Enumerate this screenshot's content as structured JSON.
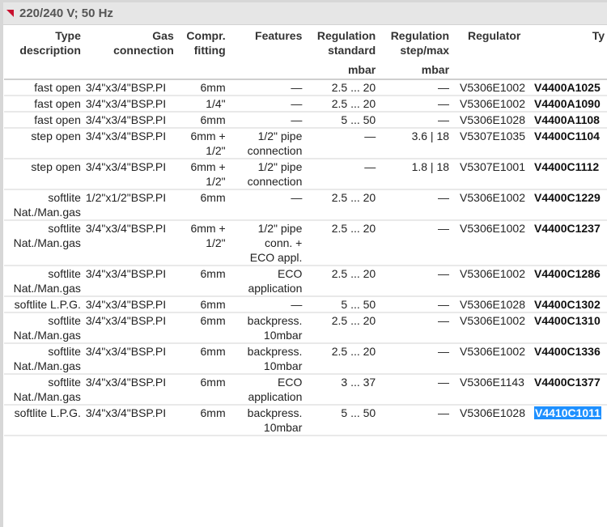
{
  "section": {
    "title": "220/240 V; 50 Hz"
  },
  "headers": {
    "type_description": [
      "Type",
      "description"
    ],
    "gas_connection": [
      "Gas",
      "connection"
    ],
    "compr_fitting": [
      "Compr.",
      "fitting"
    ],
    "features": [
      "Features"
    ],
    "regulation_standard": [
      "Regulation",
      "standard"
    ],
    "regulation_stepmax": [
      "Regulation",
      "step/max"
    ],
    "regulator": [
      "Regulator"
    ],
    "type": [
      "Ty"
    ],
    "unit_standard": "mbar",
    "unit_stepmax": "mbar"
  },
  "rows": [
    {
      "desc": [
        "fast open"
      ],
      "gas": "3/4\"x3/4\"BSP.PI",
      "compr": [
        "6mm"
      ],
      "features": [
        "—"
      ],
      "std": "2.5 ... 20",
      "step": "—",
      "regulator": "V5306E1002",
      "type": "V4400A1025"
    },
    {
      "desc": [
        "fast open"
      ],
      "gas": "3/4\"x3/4\"BSP.PI",
      "compr": [
        "1/4\""
      ],
      "features": [
        "—"
      ],
      "std": "2.5 ... 20",
      "step": "—",
      "regulator": "V5306E1002",
      "type": "V4400A1090"
    },
    {
      "desc": [
        "fast open"
      ],
      "gas": "3/4\"x3/4\"BSP.PI",
      "compr": [
        "6mm"
      ],
      "features": [
        "—"
      ],
      "std": "5 ... 50",
      "step": "—",
      "regulator": "V5306E1028",
      "type": "V4400A1108"
    },
    {
      "desc": [
        "step open"
      ],
      "gas": "3/4\"x3/4\"BSP.PI",
      "compr": [
        "6mm +",
        "1/2\""
      ],
      "features": [
        "1/2\" pipe",
        "connection"
      ],
      "std": "—",
      "step": "3.6 | 18",
      "regulator": "V5307E1035",
      "type": "V4400C1104"
    },
    {
      "desc": [
        "step open"
      ],
      "gas": "3/4\"x3/4\"BSP.PI",
      "compr": [
        "6mm +",
        "1/2\""
      ],
      "features": [
        "1/2\" pipe",
        "connection"
      ],
      "std": "—",
      "step": "1.8 | 18",
      "regulator": "V5307E1001",
      "type": "V4400C1112"
    },
    {
      "desc": [
        "softlite",
        "Nat./Man.gas"
      ],
      "gas": "1/2\"x1/2\"BSP.PI",
      "compr": [
        "6mm"
      ],
      "features": [
        "—"
      ],
      "std": "2.5 ... 20",
      "step": "—",
      "regulator": "V5306E1002",
      "type": "V4400C1229"
    },
    {
      "desc": [
        "softlite",
        "Nat./Man.gas"
      ],
      "gas": "3/4\"x3/4\"BSP.PI",
      "compr": [
        "6mm +",
        "1/2\""
      ],
      "features": [
        "1/2\" pipe",
        "conn. +",
        "ECO appl."
      ],
      "std": "2.5 ... 20",
      "step": "—",
      "regulator": "V5306E1002",
      "type": "V4400C1237"
    },
    {
      "desc": [
        "softlite",
        "Nat./Man.gas"
      ],
      "gas": "3/4\"x3/4\"BSP.PI",
      "compr": [
        "6mm"
      ],
      "features": [
        "ECO",
        "application"
      ],
      "std": "2.5 ... 20",
      "step": "—",
      "regulator": "V5306E1002",
      "type": "V4400C1286"
    },
    {
      "desc": [
        "softlite L.P.G."
      ],
      "gas": "3/4\"x3/4\"BSP.PI",
      "compr": [
        "6mm"
      ],
      "features": [
        "—"
      ],
      "std": "5 ... 50",
      "step": "—",
      "regulator": "V5306E1028",
      "type": "V4400C1302"
    },
    {
      "desc": [
        "softlite",
        "Nat./Man.gas"
      ],
      "gas": "3/4\"x3/4\"BSP.PI",
      "compr": [
        "6mm"
      ],
      "features": [
        "backpress.",
        "10mbar"
      ],
      "std": "2.5 ... 20",
      "step": "—",
      "regulator": "V5306E1002",
      "type": "V4400C1310"
    },
    {
      "desc": [
        "softlite",
        "Nat./Man.gas"
      ],
      "gas": "3/4\"x3/4\"BSP.PI",
      "compr": [
        "6mm"
      ],
      "features": [
        "backpress.",
        "10mbar"
      ],
      "std": "2.5 ... 20",
      "step": "—",
      "regulator": "V5306E1002",
      "type": "V4400C1336"
    },
    {
      "desc": [
        "softlite",
        "Nat./Man.gas"
      ],
      "gas": "3/4\"x3/4\"BSP.PI",
      "compr": [
        "6mm"
      ],
      "features": [
        "ECO",
        "application"
      ],
      "std": "3 ... 37",
      "step": "—",
      "regulator": "V5306E1143",
      "type": "V4400C1377"
    },
    {
      "desc": [
        "softlite L.P.G."
      ],
      "gas": "3/4\"x3/4\"BSP.PI",
      "compr": [
        "6mm"
      ],
      "features": [
        "backpress.",
        "10mbar"
      ],
      "std": "5 ... 50",
      "step": "—",
      "regulator": "V5306E1028",
      "type": "V4410C1011",
      "selected": true
    }
  ],
  "colors": {
    "marker": "#c8102e",
    "selection": "#1e90ff",
    "section_bg": "#e6e6e6"
  }
}
